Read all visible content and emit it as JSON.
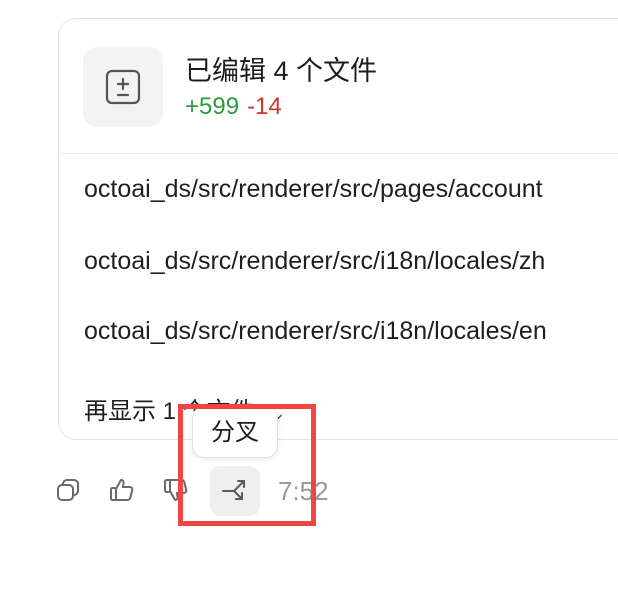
{
  "card": {
    "title": "已编辑 4 个文件",
    "added": "+599",
    "removed": "-14",
    "icon": "file-diff-icon",
    "files": [
      "octoai_ds/src/renderer/src/pages/account",
      "octoai_ds/src/renderer/src/i18n/locales/zh",
      "octoai_ds/src/renderer/src/i18n/locales/en"
    ],
    "show_more_label": "再显示 1 个文件",
    "show_more_icon": "chevron-down-icon"
  },
  "tooltip": {
    "text": "分叉"
  },
  "actions": {
    "copy_icon": "copy-icon",
    "like_icon": "thumbs-up-icon",
    "dislike_icon": "thumbs-down-icon",
    "fork_icon": "fork-icon",
    "time": "7:52"
  },
  "colors": {
    "added": "#2e9b3e",
    "removed": "#d0352b",
    "highlight": "#ef4545"
  }
}
